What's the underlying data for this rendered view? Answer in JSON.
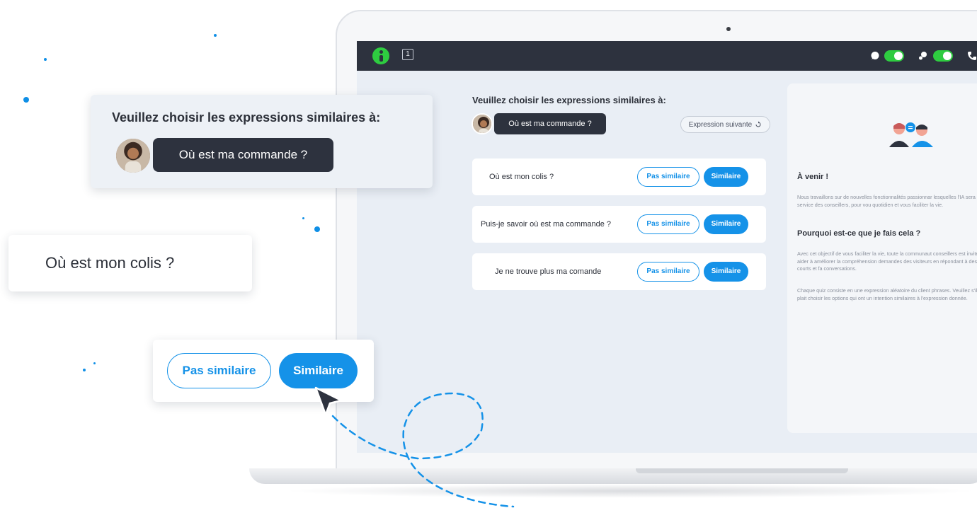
{
  "app": {
    "tab_badge": "1",
    "brand_color": "#2ecc40",
    "accent_color": "#1592e8"
  },
  "topbar": {
    "icons": [
      "logo-icon",
      "chat-bubble-icon",
      "chat-users-icon",
      "phone-icon"
    ]
  },
  "quiz": {
    "title": "Veuillez choisir les expressions similaires à:",
    "expression": "Où est ma commande ?",
    "next_label": "Expression suivante",
    "not_similar_label": "Pas similaire",
    "similar_label": "Similaire",
    "rows": [
      {
        "text": "Où est mon colis ?"
      },
      {
        "text": "Puis-je savoir où est ma commande ?"
      },
      {
        "text": "Je ne trouve plus ma comande"
      }
    ]
  },
  "side_panel": {
    "heading_1": "À venir !",
    "paragraph_1": "Nous travaillons sur de nouvelles fonctionnalités passionnar lesquelles l'IA sera mise au service des conseillers, pour vou quotidien et vous faciliter la vie.",
    "heading_2": "Pourquoi est-ce que je fais cela ?",
    "paragraph_2": "Avec cet objectif de vous faciliter la vie, toute la communaut conseillers est invitée à aider à améliorer la compréhension demandes des visiteurs en répondant à des quiz courts et fa conversations.",
    "paragraph_3": "Chaque quiz consiste en une expression aléatoire du client phrases. Veuillez s'il vous plait choisir les options qui ont un intention similaires à l'expression donnée."
  },
  "callouts": {
    "title": "Veuillez choisir les expressions similaires à:",
    "expression": "Où est ma commande ?",
    "option": "Où est mon colis ?",
    "not_similar_label": "Pas similaire",
    "similar_label": "Similaire"
  }
}
